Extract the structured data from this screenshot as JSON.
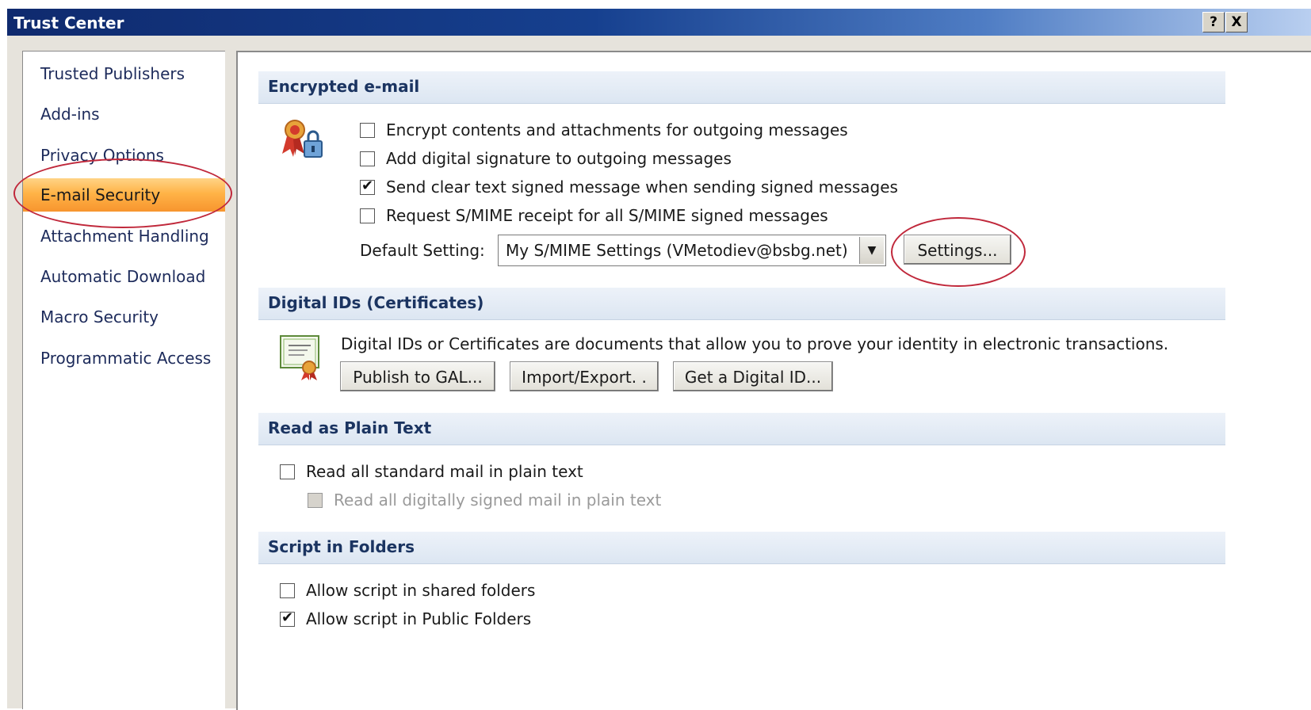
{
  "window": {
    "title": "Trust Center",
    "help_label": "?",
    "close_label": "X"
  },
  "sidebar": {
    "items": [
      {
        "label": "Trusted Publishers"
      },
      {
        "label": "Add-ins"
      },
      {
        "label": "Privacy Options"
      },
      {
        "label": "E-mail Security",
        "selected": true
      },
      {
        "label": "Attachment Handling"
      },
      {
        "label": "Automatic Download"
      },
      {
        "label": "Macro Security"
      },
      {
        "label": "Programmatic Access"
      }
    ]
  },
  "encrypted": {
    "heading": "Encrypted e-mail",
    "options": [
      {
        "label": "Encrypt contents and attachments for outgoing messages",
        "checked": false
      },
      {
        "label": "Add digital signature to outgoing messages",
        "checked": false
      },
      {
        "label": "Send clear text signed message when sending signed messages",
        "checked": true
      },
      {
        "label": "Request S/MIME receipt for all S/MIME signed messages",
        "checked": false
      }
    ],
    "default_label": "Default Setting:",
    "default_value": "My S/MIME Settings (VMetodiev@bsbg.net)",
    "settings_button": "Settings..."
  },
  "digital_ids": {
    "heading": "Digital IDs (Certificates)",
    "description": "Digital IDs or Certificates are documents that allow you to prove your identity in electronic transactions.",
    "buttons": [
      "Publish to GAL...",
      "Import/Export. .",
      "Get a Digital ID..."
    ]
  },
  "plain_text": {
    "heading": "Read as Plain Text",
    "options": [
      {
        "label": "Read all standard mail in plain text",
        "checked": false,
        "enabled": true
      },
      {
        "label": "Read all digitally signed mail in plain text",
        "checked": false,
        "enabled": false
      }
    ]
  },
  "script_folders": {
    "heading": "Script in Folders",
    "options": [
      {
        "label": "Allow script in shared folders",
        "checked": false
      },
      {
        "label": "Allow script in Public Folders",
        "checked": true
      }
    ]
  },
  "icons": {
    "security_icon": "ribbon-lock-icon",
    "certificate_icon": "certificate-icon"
  },
  "colors": {
    "highlight_ring": "#c0283b",
    "selected_item": "#f7952e",
    "title_bar": "#16408f"
  }
}
